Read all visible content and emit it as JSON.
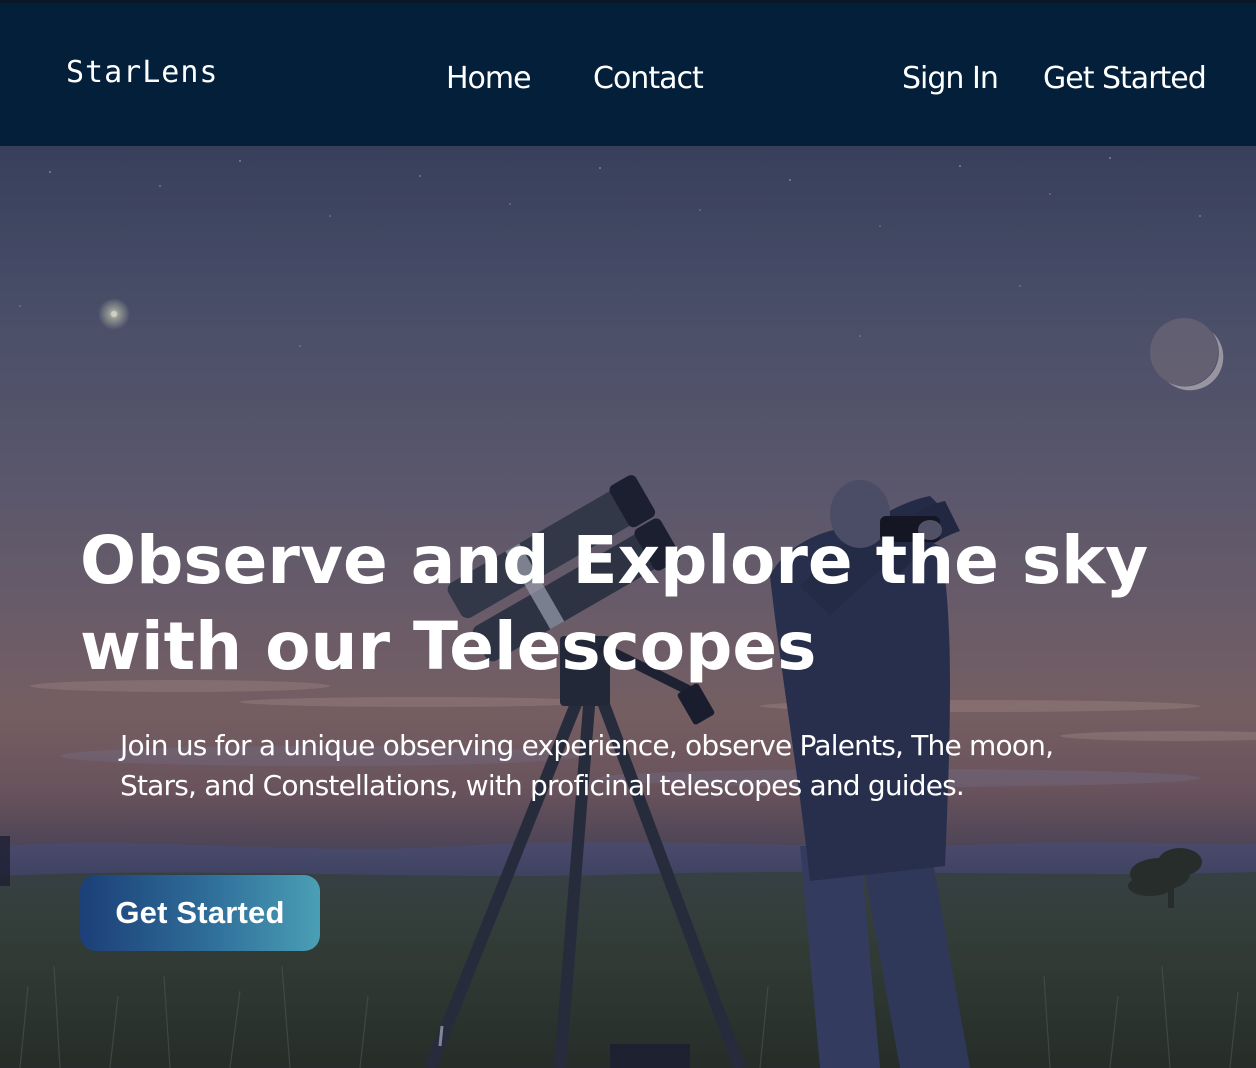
{
  "nav": {
    "logo": "StarLens",
    "links": {
      "home": "Home",
      "contact": "Contact"
    },
    "sign_in": "Sign In",
    "get_started": "Get Started"
  },
  "hero": {
    "title_line1": "Observe and Explore the sky",
    "title_line2": "with our Telescopes",
    "subtitle_line1": "Join us for a unique observing experience, observe Palents, The moon,",
    "subtitle_line2": "Stars, and Constellations, with proficinal telescopes and guides.",
    "cta_label": "Get Started"
  },
  "colors": {
    "nav_background": "#031f3a",
    "cta_gradient_start": "#1c3f78",
    "cta_gradient_end": "#4a9fb5",
    "text": "#ffffff"
  }
}
